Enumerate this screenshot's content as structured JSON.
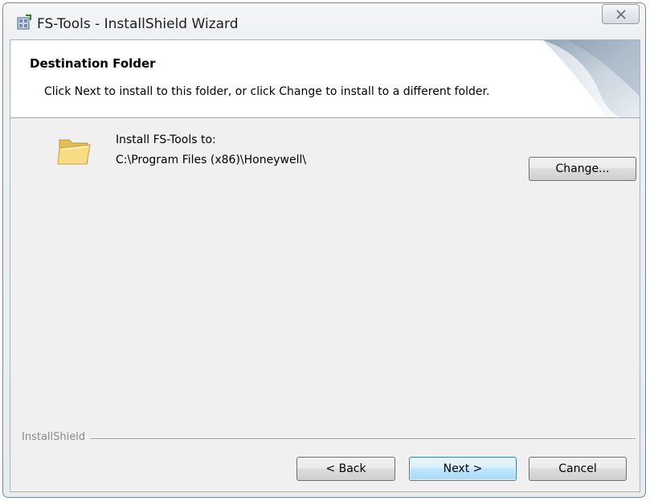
{
  "window": {
    "title": "FS-Tools - InstallShield Wizard",
    "close_glyph": "☒"
  },
  "banner": {
    "title": "Destination Folder",
    "description": "Click Next to install to this folder, or click Change to install to a different folder."
  },
  "destination": {
    "label": "Install FS-Tools to:",
    "path": "C:\\Program Files (x86)\\Honeywell\\",
    "change_label": "Change..."
  },
  "footer": {
    "brand": "InstallShield",
    "back_label": "< Back",
    "next_label": "Next >",
    "cancel_label": "Cancel"
  },
  "icons": {
    "app": "installer-icon",
    "folder": "folder-icon",
    "close": "close-icon"
  }
}
